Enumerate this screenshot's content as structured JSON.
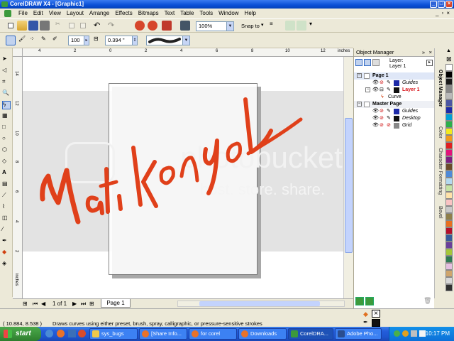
{
  "window": {
    "title": "CorelDRAW X4 - [Graphic1]"
  },
  "menu": [
    "File",
    "Edit",
    "View",
    "Layout",
    "Arrange",
    "Effects",
    "Bitmaps",
    "Text",
    "Table",
    "Tools",
    "Window",
    "Help"
  ],
  "toolbar": {
    "zoom": "100%",
    "snap_to": "Snap to"
  },
  "propertybar": {
    "smoothing": "100",
    "width": "0.394 \""
  },
  "ruler": {
    "units": "inches",
    "h_ticks": [
      "4",
      "2",
      "0",
      "2",
      "4",
      "6",
      "8",
      "10",
      "12"
    ],
    "v_ticks": [
      "14",
      "12",
      "10",
      "8",
      "6",
      "4",
      "2",
      "0"
    ],
    "v_units": "inches"
  },
  "canvas": {
    "drawing_text": "MatikonyoL",
    "stroke_color": "#e0401a",
    "watermark": "photobucket",
    "watermark_sub": "host. store. share."
  },
  "page_nav": {
    "counter": "1 of 1",
    "page_tab": "Page 1"
  },
  "docker": {
    "title": "Object Manager",
    "layer_label": "Layer:",
    "layer_value": "Layer 1",
    "tree": [
      {
        "label": "Page 1",
        "level": 0,
        "bold": true
      },
      {
        "label": "Guides",
        "level": 1,
        "color": "#1d2aa8"
      },
      {
        "label": "Layer 1",
        "level": 1,
        "color": "#d8141a",
        "bold": true
      },
      {
        "label": "Curve",
        "level": 2
      },
      {
        "label": "Master Page",
        "level": 0,
        "bold": true
      },
      {
        "label": "Guides",
        "level": 1,
        "color": "#1d2aa8"
      },
      {
        "label": "Desktop",
        "level": 1,
        "color": "#111111"
      },
      {
        "label": "Grid",
        "level": 1,
        "color": "#888888"
      }
    ]
  },
  "side_tabs": [
    "Object Manager",
    "Color",
    "Character Formatting",
    "Bevel"
  ],
  "palette": [
    "#ffffff",
    "#000000",
    "#1a1a1a",
    "#888888",
    "#b9b9b9",
    "#4b56a3",
    "#1d2aa8",
    "#00a0d6",
    "#2ab04a",
    "#f2ea1e",
    "#f19a1c",
    "#e02020",
    "#e1147a",
    "#7b1f80",
    "#6a4b2a",
    "#4e8ad8",
    "#b3d9f0",
    "#c4e3a5",
    "#ffe2a8",
    "#f9c3c3",
    "#c9c9c9",
    "#8f7f4a",
    "#e86f1f",
    "#b4102b",
    "#365c9a",
    "#6a3f9a",
    "#a4c639",
    "#2d7a53",
    "#e4bfe0",
    "#cfa56b",
    "#d8d8d8",
    "#303030"
  ],
  "status": {
    "coords": "( 10.884, 8.538 )",
    "hint": "Draws curves using either preset, brush, spray, calligraphic, or pressure-sensitive strokes"
  },
  "taskbar": {
    "start": "start",
    "tasks": [
      "sys_bugs",
      "[Share Info...",
      "for corel",
      "Downloads",
      "CorelDRA...",
      "Adobe Pho..."
    ],
    "clock": "10:17 PM"
  }
}
